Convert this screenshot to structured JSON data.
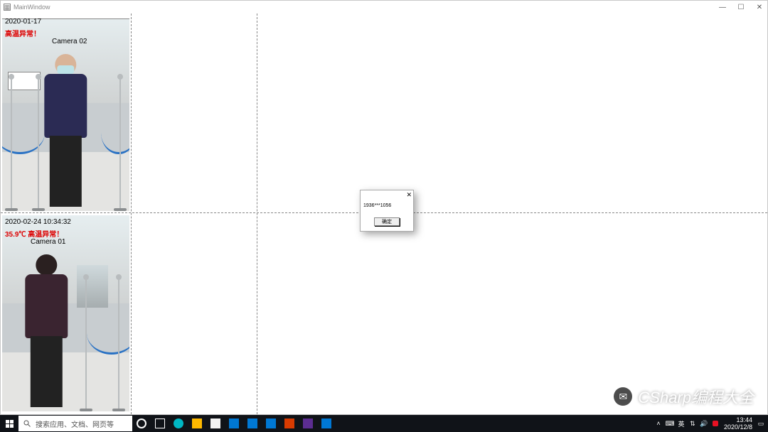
{
  "window": {
    "title": "MainWindow",
    "controls": {
      "min": "—",
      "max": "☐",
      "close": "✕"
    }
  },
  "cameras": [
    {
      "timestamp": "2020-01-17",
      "alert": "高温异常！",
      "label": "Camera 02",
      "torso_color": "#2b2b54"
    },
    {
      "timestamp": "2020-02-24  10:34:32",
      "alert": "35.9℃ 高温异常！",
      "label": "Camera 01",
      "torso_color": "#3a2430"
    }
  ],
  "dialog": {
    "message": "1936***1056",
    "ok": "确定",
    "close": "✕"
  },
  "taskbar": {
    "search_placeholder": "搜索应用、文档、网页等",
    "icons": [
      "cortana",
      "task-view",
      "edge",
      "folder",
      "store",
      "mail",
      "settings",
      "calendar",
      "word",
      "vs",
      "pix"
    ],
    "tray": [
      "up",
      "input",
      "ime",
      "wifi",
      "vol",
      "red"
    ],
    "time": "13:44",
    "date": "2020/12/8"
  },
  "watermark": {
    "text": "CSharp编程大全"
  }
}
